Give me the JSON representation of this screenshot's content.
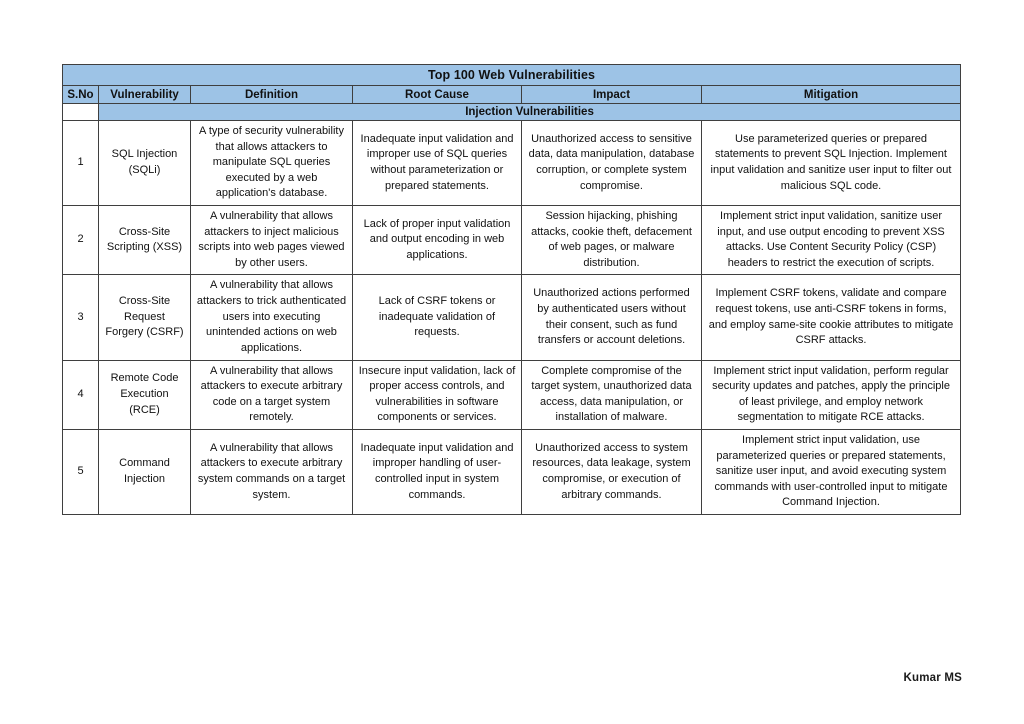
{
  "document": {
    "title": "Top 100  Web Vulnerabilities",
    "footer_author": "Kumar MS",
    "header_fill_color": "#9DC3E6",
    "border_color": "#3f3f3f"
  },
  "table": {
    "columns": [
      {
        "key": "sno",
        "label": "S.No"
      },
      {
        "key": "vulnerability",
        "label": "Vulnerability"
      },
      {
        "key": "definition",
        "label": "Definition"
      },
      {
        "key": "root_cause",
        "label": "Root Cause"
      },
      {
        "key": "impact",
        "label": "Impact"
      },
      {
        "key": "mitigation",
        "label": "Mitigation"
      }
    ],
    "section_label": "Injection Vulnerabilities",
    "rows": [
      {
        "sno": "1",
        "vulnerability": "SQL Injection (SQLi)",
        "definition": "A type of security vulnerability that allows attackers to manipulate SQL queries executed by a web application's database.",
        "root_cause": "Inadequate input validation and improper use of SQL queries without parameterization or prepared statements.",
        "impact": "Unauthorized access to sensitive data, data manipulation, database corruption, or complete system compromise.",
        "mitigation": "Use parameterized queries or prepared statements to prevent SQL Injection. Implement input validation and sanitize user input to filter out malicious SQL code."
      },
      {
        "sno": "2",
        "vulnerability": "Cross-Site Scripting (XSS)",
        "definition": "A vulnerability that allows attackers to inject malicious scripts into web pages viewed by other users.",
        "root_cause": "Lack of proper input validation and output encoding in web applications.",
        "impact": "Session hijacking, phishing attacks, cookie theft, defacement of web pages, or malware distribution.",
        "mitigation": "Implement strict input validation, sanitize user input, and use output encoding to prevent XSS attacks. Use Content Security Policy (CSP) headers to restrict the execution of scripts."
      },
      {
        "sno": "3",
        "vulnerability": "Cross-Site Request Forgery (CSRF)",
        "definition": "A vulnerability that allows attackers to trick authenticated users into executing unintended actions on web applications.",
        "root_cause": "Lack of CSRF tokens or inadequate validation of requests.",
        "impact": "Unauthorized actions performed by authenticated users without their consent, such as fund transfers or account deletions.",
        "mitigation": "Implement CSRF tokens, validate and compare request tokens, use anti-CSRF tokens in forms, and employ same-site cookie attributes to mitigate CSRF attacks."
      },
      {
        "sno": "4",
        "vulnerability": "Remote Code Execution (RCE)",
        "definition": "A vulnerability that allows attackers to execute arbitrary code on a target system remotely.",
        "root_cause": "Insecure input validation, lack of proper access controls, and vulnerabilities in software components or services.",
        "impact": "Complete compromise of the target system, unauthorized data access, data manipulation, or installation of malware.",
        "mitigation": "Implement strict input validation, perform regular security updates and patches, apply the principle of least privilege, and employ network segmentation to mitigate RCE attacks."
      },
      {
        "sno": "5",
        "vulnerability": "Command Injection",
        "definition": "A vulnerability that allows attackers to execute arbitrary system commands on a target system.",
        "root_cause": "Inadequate input validation and improper handling of user-controlled input in system commands.",
        "impact": "Unauthorized access to system resources, data leakage, system compromise, or execution of arbitrary commands.",
        "mitigation": "Implement strict input validation, use parameterized queries or prepared statements, sanitize user input, and avoid executing system commands with user-controlled input to mitigate Command Injection."
      }
    ]
  }
}
